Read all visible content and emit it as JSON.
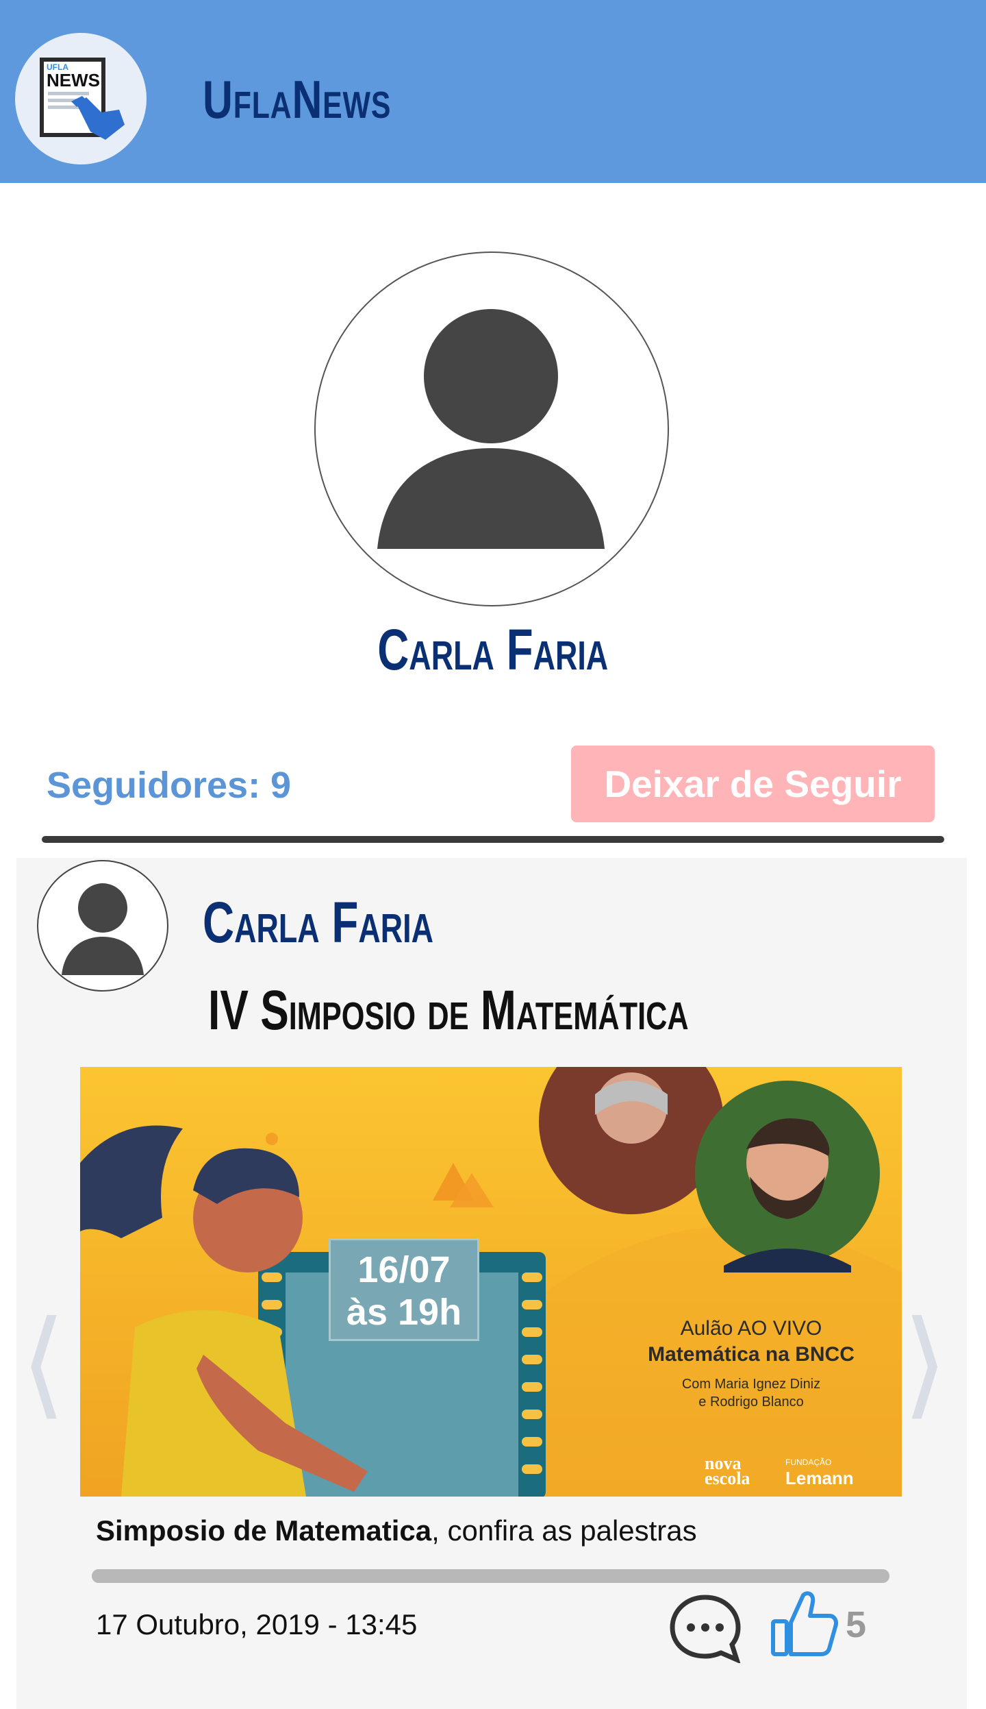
{
  "header": {
    "app_title": "UflaNews",
    "logo_text_top": "UFLA",
    "logo_text_main": "NEWS"
  },
  "profile": {
    "name": "Carla Faria",
    "followers_label": "Seguidores: 9",
    "unfollow_label": "Deixar de Seguir"
  },
  "post": {
    "author": "Carla Faria",
    "title": "IV Simposio de Matemática",
    "caption_bold": "Simposio de Matematica",
    "caption_rest": ", confira as palestras",
    "date": "17 Outubro, 2019 - 13:45",
    "likes": "5",
    "carousel_progress": 1.0,
    "banner": {
      "date_line1": "16/07",
      "date_line2": "às 19h",
      "sub1": "Aulão AO VIVO",
      "sub2": "Matemática na BNCC",
      "sub3a": "Com Maria Ignez Diniz",
      "sub3b": "e Rodrigo Blanco",
      "logo1a": "nova",
      "logo1b": "escola",
      "logo2a": "FUNDAÇÃO",
      "logo2b": "Lemann"
    }
  },
  "colors": {
    "header_bg": "#5f99dd",
    "title_navy": "#0b2f73",
    "followers_blue": "#5b95d8",
    "unfollow_pink": "#ffb4b8",
    "like_blue": "#2f8fe0"
  },
  "icons": {
    "prev": "chevron-left-icon",
    "next": "chevron-right-icon",
    "comment": "comment-bubble-icon",
    "like": "thumbs-up-icon"
  }
}
